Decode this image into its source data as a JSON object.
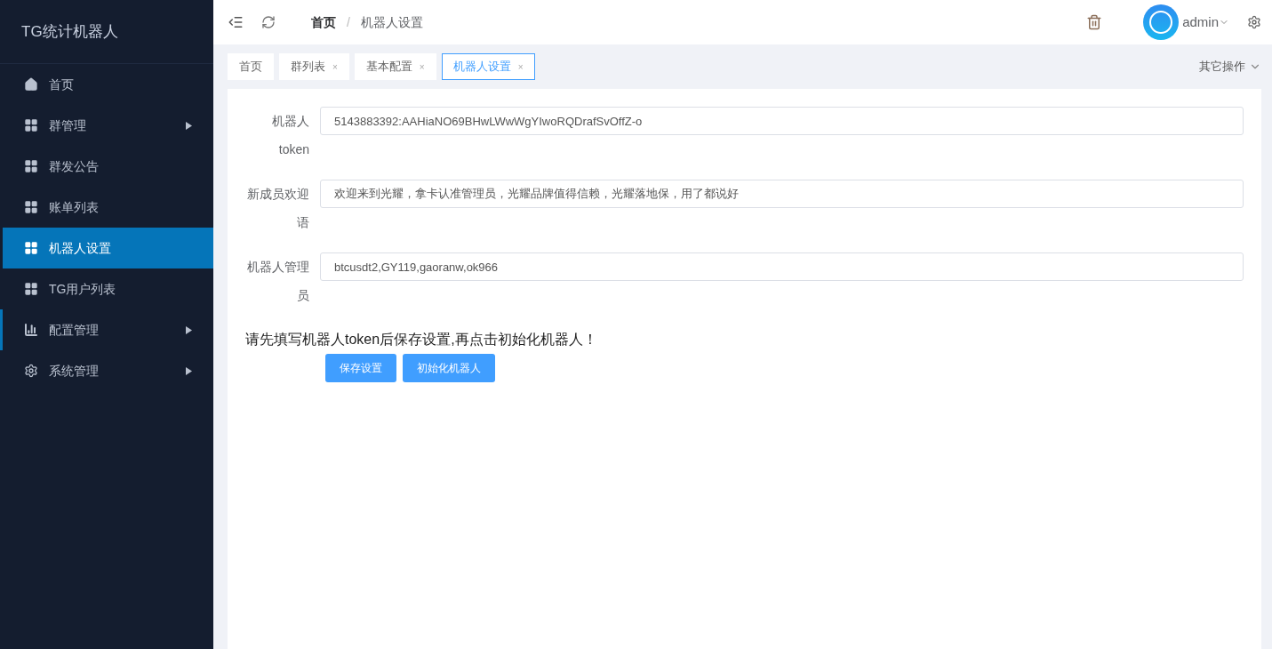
{
  "sidebar": {
    "title": "TG统计机器人",
    "items": [
      {
        "label": "首页",
        "kind": "home",
        "submenu": false,
        "selected": false,
        "focused": false
      },
      {
        "label": "群管理",
        "kind": "grid",
        "submenu": true,
        "selected": false,
        "focused": false
      },
      {
        "label": "群发公告",
        "kind": "grid",
        "submenu": false,
        "selected": false,
        "focused": false
      },
      {
        "label": "账单列表",
        "kind": "grid",
        "submenu": false,
        "selected": false,
        "focused": false
      },
      {
        "label": "机器人设置",
        "kind": "grid",
        "submenu": false,
        "selected": true,
        "focused": false
      },
      {
        "label": "TG用户列表",
        "kind": "grid",
        "submenu": false,
        "selected": false,
        "focused": false
      },
      {
        "label": "配置管理",
        "kind": "chart",
        "submenu": true,
        "selected": false,
        "focused": true
      },
      {
        "label": "系统管理",
        "kind": "gear",
        "submenu": true,
        "selected": false,
        "focused": false
      }
    ]
  },
  "header": {
    "breadcrumb": [
      "首页",
      "机器人设置"
    ],
    "separator": "/",
    "user": "admin"
  },
  "tabs": [
    {
      "label": "首页",
      "closable": false,
      "selected": false
    },
    {
      "label": "群列表",
      "closable": true,
      "selected": false
    },
    {
      "label": "基本配置",
      "closable": true,
      "selected": false
    },
    {
      "label": "机器人设置",
      "closable": true,
      "selected": true
    }
  ],
  "close_mark": "×",
  "other_actions": "其它操作",
  "form": {
    "fields": [
      {
        "label": "机器人token",
        "value": "5143883392:AAHiaNO69BHwLWwWgYIwoRQDrafSvOffZ-o"
      },
      {
        "label": "新成员欢迎语",
        "value": "欢迎来到光耀，拿卡认准管理员，光耀品牌值得信赖，光耀落地保，用了都说好"
      },
      {
        "label": "机器人管理员",
        "value": "btcusdt2,GY119,gaoranw,ok966"
      }
    ],
    "notice": "请先填写机器人token后保存设置,再点击初始化机器人！",
    "buttons": [
      "保存设置",
      "初始化机器人"
    ]
  }
}
